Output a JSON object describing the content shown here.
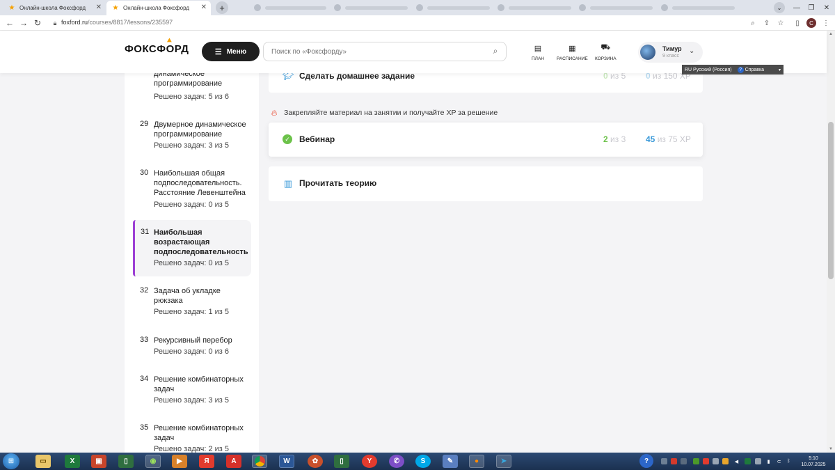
{
  "browser": {
    "tabs": [
      {
        "title": "Онлайн-школа Фоксфорд",
        "active": false
      },
      {
        "title": "Онлайн-школа Фоксфорд",
        "active": true
      }
    ],
    "url_host": "foxford.ru",
    "url_path": "/courses/8817/lessons/235597",
    "profile_initial": "С"
  },
  "header": {
    "logo": "ФОКСФОРД",
    "menu_label": "Меню",
    "search_placeholder": "Поиск по «Фоксфорду»",
    "links": {
      "plan": "ПЛАН",
      "schedule": "РАСПИСАНИЕ",
      "cart": "КОРЗИНА"
    },
    "user_name": "Тимур",
    "user_grade": "9 класс"
  },
  "lang_popup": {
    "language": "RU Русский (Россия)",
    "help": "Справка"
  },
  "sidebar": {
    "lessons": [
      {
        "num": "",
        "title": "динамическое программирование",
        "solved": "Решено задач: 5 из 6",
        "active": false
      },
      {
        "num": "29",
        "title": "Двумерное динамическое программирование",
        "solved": "Решено задач: 3 из 5",
        "active": false
      },
      {
        "num": "30",
        "title": "Наибольшая общая подпоследовательность. Расстояние Левенштейна",
        "solved": "Решено задач: 0 из 5",
        "active": false
      },
      {
        "num": "31",
        "title": "Наибольшая возрастающая подпоследовательность",
        "solved": "Решено задач: 0 из 5",
        "active": true
      },
      {
        "num": "32",
        "title": "Задача об укладке рюкзака",
        "solved": "Решено задач: 1 из 5",
        "active": false
      },
      {
        "num": "33",
        "title": "Рекурсивный перебор",
        "solved": "Решено задач: 0 из 6",
        "active": false
      },
      {
        "num": "34",
        "title": "Решение комбинаторных задач",
        "solved": "Решено задач: 3 из 5",
        "active": false
      },
      {
        "num": "35",
        "title": "Решение комбинаторных задач",
        "solved": "Решено задач: 2 из 5",
        "active": false
      }
    ]
  },
  "main": {
    "homework": {
      "title": "Сделать домашнее задание",
      "done": "0",
      "done_total": "из 5",
      "xp": "0",
      "xp_total": "из 150 XP"
    },
    "hint": "Закрепляйте материал на занятии и получайте XP за решение",
    "webinar": {
      "title": "Вебинар",
      "done": "2",
      "done_total": "из 3",
      "xp": "45",
      "xp_total": "из 75 XP"
    },
    "theory": {
      "title": "Прочитать теорию"
    }
  },
  "colors": {
    "accent_green": "#6cc24a",
    "accent_blue": "#3b9ad9",
    "active_lesson_border": "#9c3fd4",
    "menu_button": "#1f1f1f"
  },
  "taskbar": {
    "apps": [
      "explorer",
      "excel",
      "presentation",
      "folder",
      "cinema",
      "player",
      "yandex-browser",
      "acrobat",
      "chrome",
      "word",
      "media",
      "folder2",
      "yandex",
      "viber",
      "skype",
      "paint",
      "firefox",
      "telegram"
    ],
    "time": "5:10",
    "date": "10.07.2025"
  }
}
